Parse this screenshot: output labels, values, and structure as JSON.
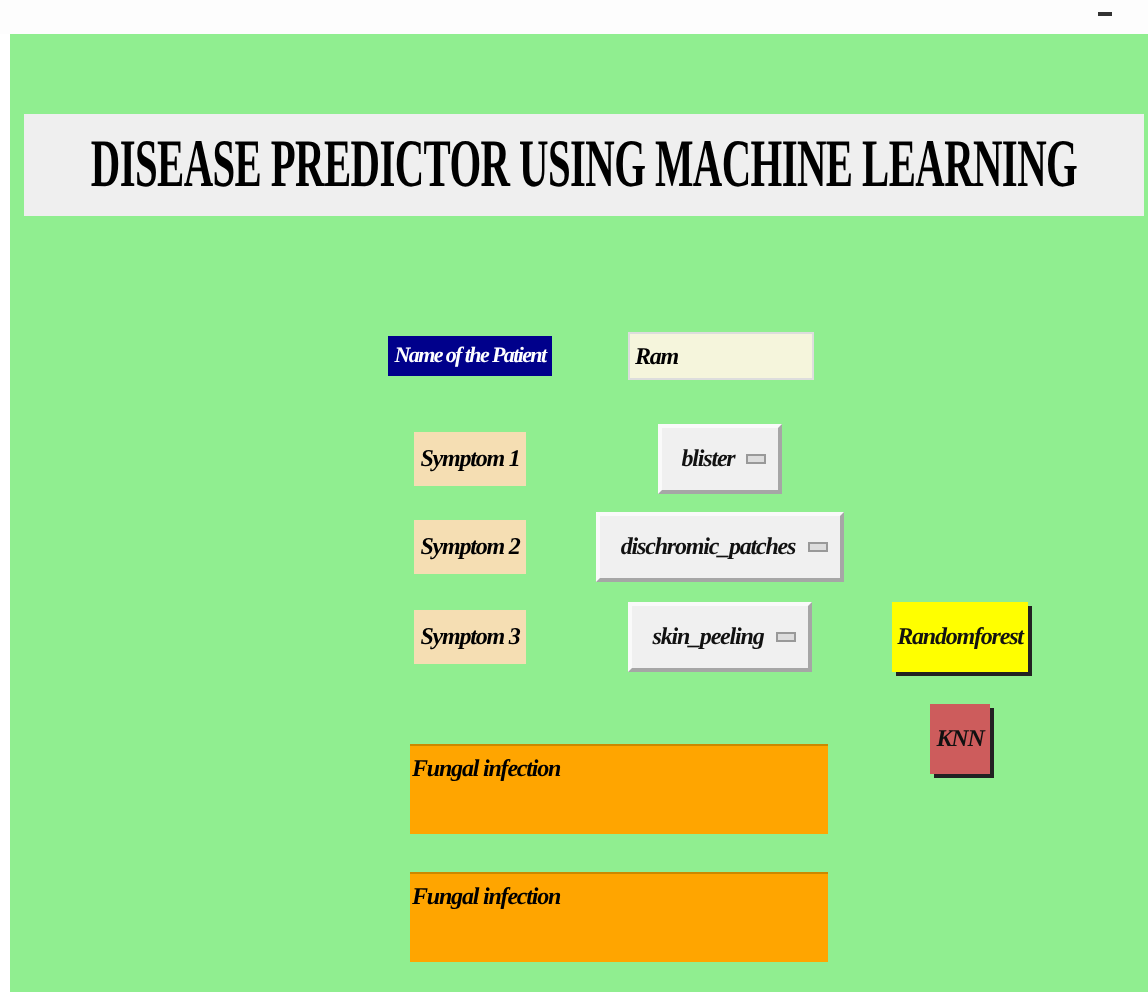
{
  "title": "DISEASE PREDICTOR USING MACHINE LEARNING",
  "patient": {
    "label": "Name of the Patient",
    "value": "Ram"
  },
  "symptoms": [
    {
      "label": "Symptom 1",
      "value": "blister"
    },
    {
      "label": "Symptom 2",
      "value": "dischromic_patches"
    },
    {
      "label": "Symptom 3",
      "value": "skin_peeling"
    }
  ],
  "buttons": [
    {
      "label": "Randomforest",
      "color": "#ffff00"
    },
    {
      "label": "KNN",
      "color": "#cd5c5c"
    }
  ],
  "results": [
    {
      "text": "Fungal infection"
    },
    {
      "text": "Fungal infection"
    }
  ]
}
